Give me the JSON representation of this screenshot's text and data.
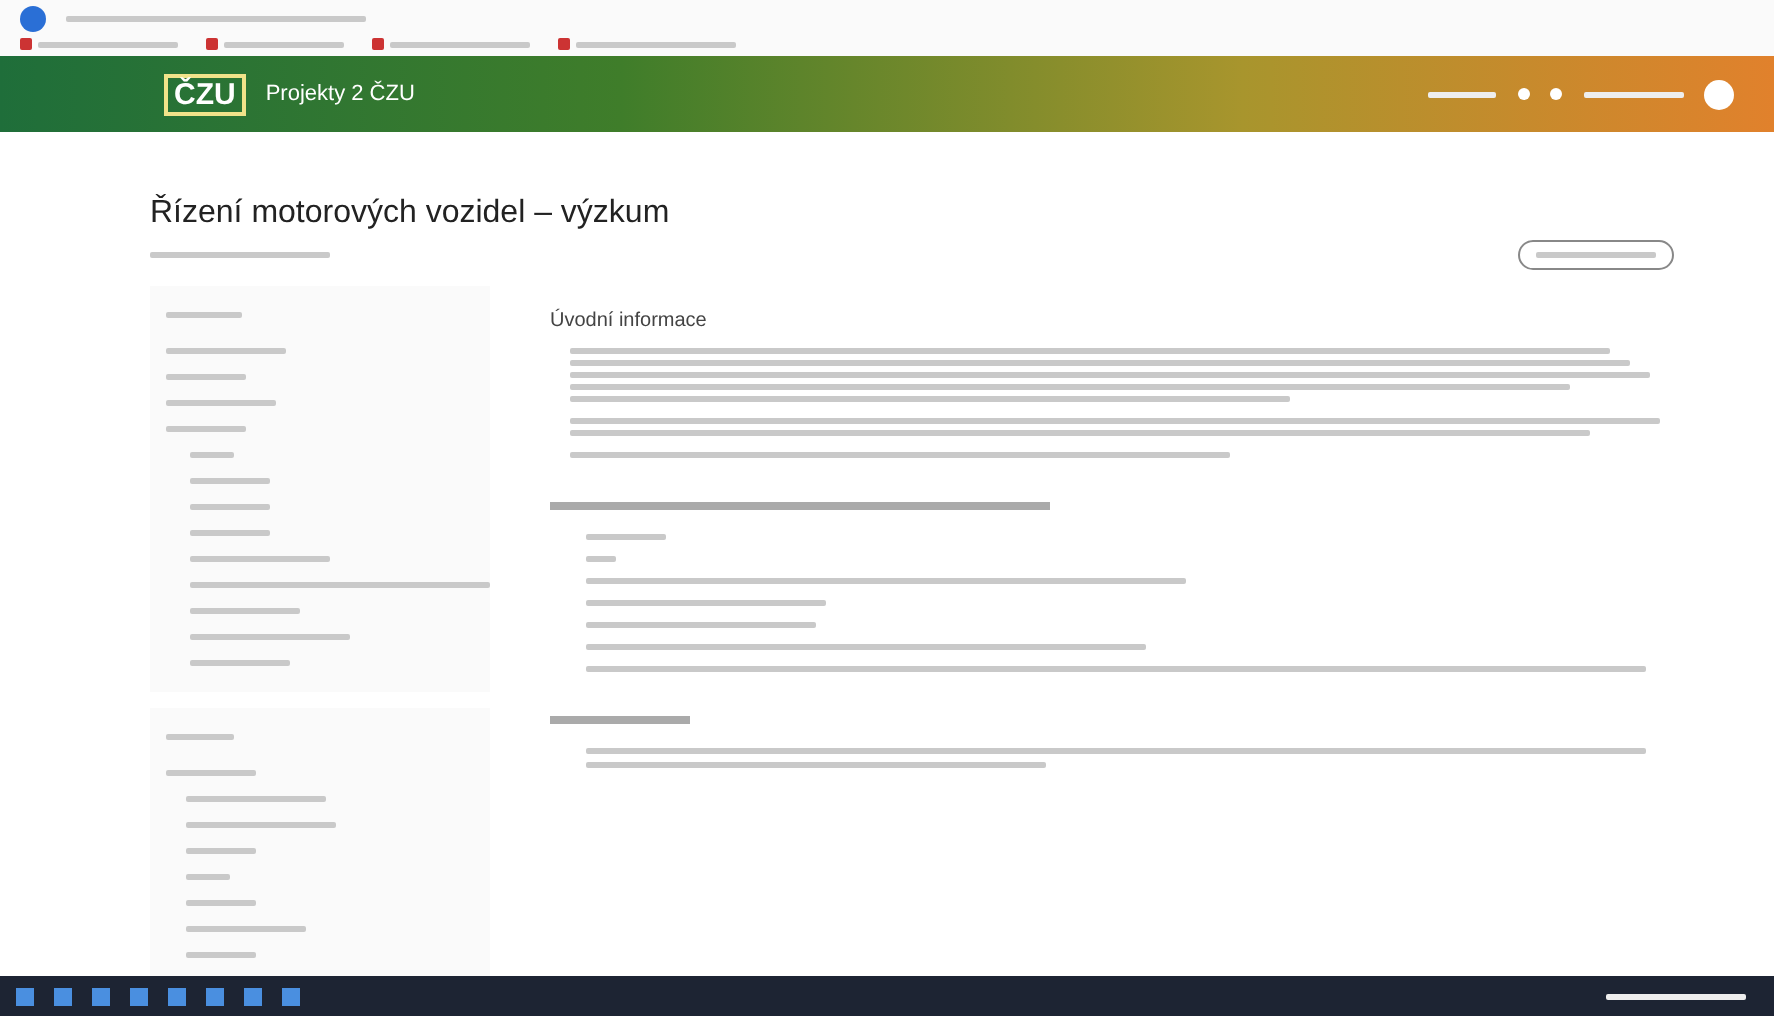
{
  "header": {
    "logo": "ČZU",
    "site_name": "Projekty 2 ČZU"
  },
  "page": {
    "title": "Řízení motorových vozidel – výzkum"
  },
  "main": {
    "sections": [
      {
        "heading": "Úvodní informace"
      }
    ]
  }
}
